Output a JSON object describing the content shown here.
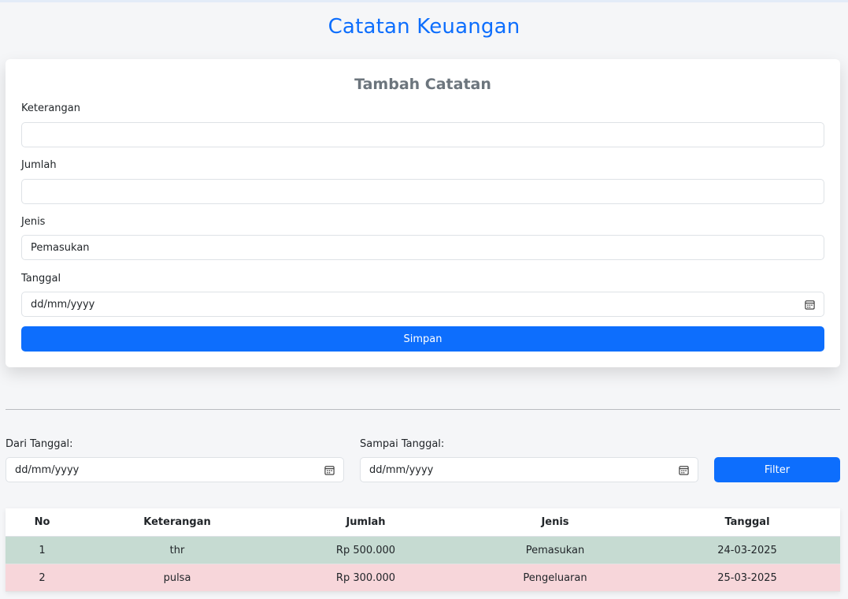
{
  "page": {
    "title": "Catatan Keuangan"
  },
  "form": {
    "title": "Tambah Catatan",
    "fields": {
      "keterangan": {
        "label": "Keterangan",
        "value": ""
      },
      "jumlah": {
        "label": "Jumlah",
        "value": ""
      },
      "jenis": {
        "label": "Jenis",
        "value": "Pemasukan"
      },
      "tanggal": {
        "label": "Tanggal",
        "value": "dd/mm/yyyy",
        "icon": "calendar-icon"
      }
    },
    "submit_label": "Simpan"
  },
  "filter": {
    "from": {
      "label": "Dari Tanggal:",
      "value": "dd/mm/yyyy",
      "icon": "calendar-icon"
    },
    "to": {
      "label": "Sampai Tanggal:",
      "value": "dd/mm/yyyy",
      "icon": "calendar-icon"
    },
    "button_label": "Filter"
  },
  "table": {
    "headers": [
      "No",
      "Keterangan",
      "Jumlah",
      "Jenis",
      "Tanggal"
    ],
    "rows": [
      {
        "no": "1",
        "keterangan": "thr",
        "jumlah": "Rp 500.000",
        "jenis": "Pemasukan",
        "tanggal": "24-03-2025",
        "status": "income"
      },
      {
        "no": "2",
        "keterangan": "pulsa",
        "jumlah": "Rp 300.000",
        "jenis": "Pengeluaran",
        "tanggal": "25-03-2025",
        "status": "expense"
      }
    ]
  },
  "colors": {
    "accent": "#0d6efd",
    "income_row": "#c6dbd2",
    "expense_row": "#f7d6da",
    "card_title": "#6c757d"
  }
}
